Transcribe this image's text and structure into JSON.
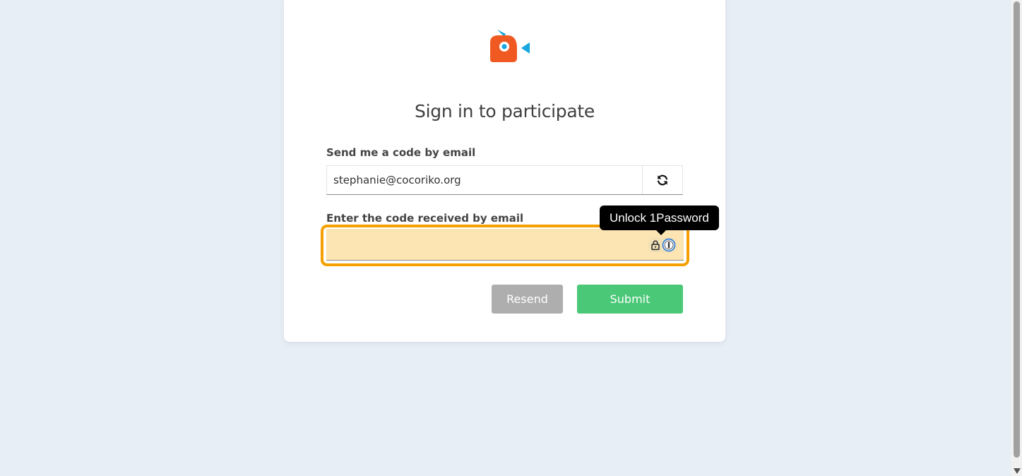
{
  "title": "Sign in to participate",
  "email_section": {
    "label": "Send me a code by email",
    "value": "stephanie@cocoriko.org"
  },
  "code_section": {
    "label": "Enter the code received by email",
    "value": ""
  },
  "tooltip": {
    "text": "Unlock 1Password"
  },
  "buttons": {
    "resend": "Resend",
    "submit": "Submit"
  },
  "colors": {
    "background": "#e8eef6",
    "brand_orange": "#f05a22",
    "brand_blue": "#16a6e0",
    "submit_green": "#4ac877",
    "resend_gray": "#aeaeae",
    "focus_outline": "#f5a000",
    "autofill_fill": "#fde4b3"
  },
  "icons": {
    "logo": "bird-logo-icon",
    "refresh": "refresh-icon",
    "lock": "lock-icon",
    "onepassword": "onepassword-icon"
  }
}
